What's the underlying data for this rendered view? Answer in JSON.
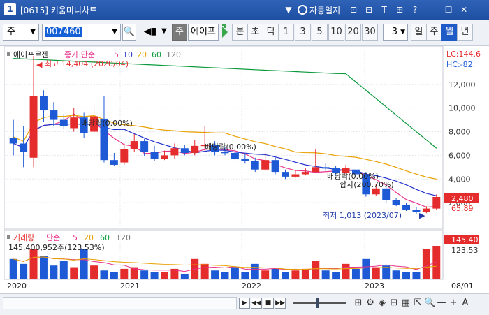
{
  "window": {
    "icon_label": "1",
    "title": "[0615] 키움미니차트",
    "auto_save": "자동일지",
    "buttons": [
      "▼",
      "⊡",
      "⊟",
      "T",
      "⊞",
      "?",
      "—",
      "☐",
      "✕"
    ]
  },
  "toolbar": {
    "market": "주",
    "code": "007460",
    "name_box": "주",
    "stock_name": "에이프",
    "period_tabs": [
      "분",
      "초",
      "틱"
    ],
    "intervals": [
      "1",
      "3",
      "5",
      "10",
      "20",
      "30"
    ],
    "interval_value": "3",
    "period_right": [
      "일",
      "주",
      "월",
      "년"
    ],
    "active_period": "월"
  },
  "price_legend": {
    "name": "에이프로젠",
    "ma_label": "종가 단순",
    "ma_periods": [
      "5",
      "10",
      "20",
      "60",
      "120"
    ],
    "ma_colors": [
      "#e8338a",
      "#2233cc",
      "#e8a100",
      "#0a9a3c",
      "#777777"
    ]
  },
  "annotations": {
    "high": "최고 14,404 (2020/04)",
    "low": "최저 1,013 (2023/07)",
    "dividend1": "배당락(0.00%)",
    "dividend2": "배당락(0.00%)",
    "dividend3": "배당락(0.00%)",
    "merge": "합자(200.70%)",
    "lc": "LC:144.6",
    "hc": "HC:-82.",
    "last_price": "2,480",
    "pct": "65.89"
  },
  "price_axis": [
    "12,000",
    "10,000",
    "8,000",
    "6,000",
    "4,000",
    "2,000"
  ],
  "volume_legend": {
    "name": "거래량",
    "ma_label": "단순",
    "ma_periods": [
      "5",
      "20",
      "60",
      "120"
    ],
    "value": "145,400,952주(123.53%)",
    "last_volume": "145.40",
    "axis_label": "123.53"
  },
  "time_axis": [
    "2020",
    "2021",
    "2022",
    "2023",
    "08/01"
  ],
  "chart_data": {
    "type": "candlestick",
    "x_labels": [
      "2020",
      "2021",
      "2022",
      "2023"
    ],
    "ylim": [
      0,
      15000
    ],
    "high": 14404,
    "low": 1013,
    "last": 2480
  },
  "colors": {
    "up": "#e52c2c",
    "down": "#1e5ad6",
    "ma5": "#e8338a",
    "ma20": "#e8a100",
    "ma60": "#0a9a3c",
    "ma120": "#777777",
    "titlebar": "#1e4fa3"
  }
}
